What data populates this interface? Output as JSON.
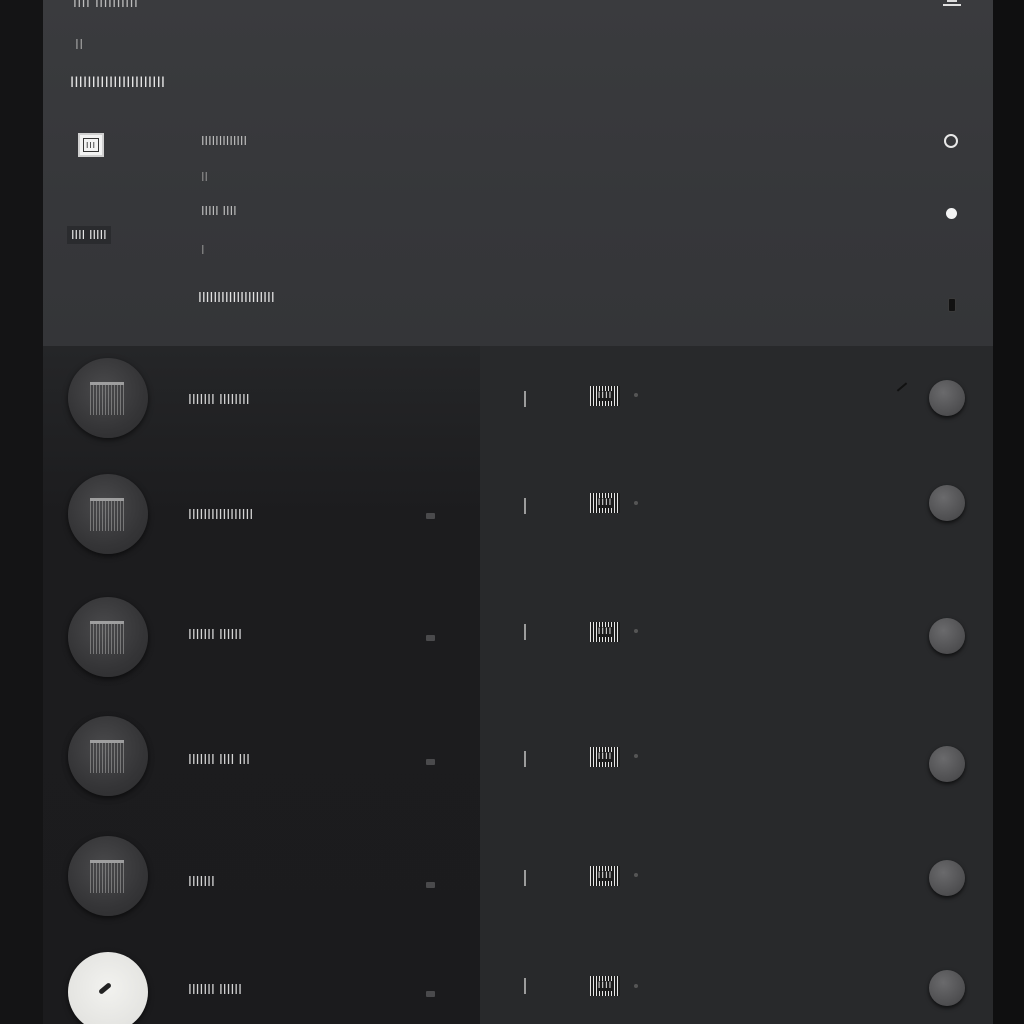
{
  "header": {
    "top_title": "IIII IIIIIIIIII",
    "top_icon": "window-icon",
    "subtitle": "II",
    "heading": "IIIIIIIIIIIIIIIIIIIIII",
    "badge_text": "III",
    "side_label": "IIII IIIII",
    "fields": [
      {
        "label": "IIIIIIIIIIIII",
        "sub": "II",
        "icon": "alarm-icon"
      },
      {
        "label": "IIIII   IIII",
        "sub": "I",
        "icon": "dot-icon"
      },
      {
        "label": "IIIIIIIIIIIIIIIIIIII",
        "icon": "small-square-icon"
      }
    ]
  },
  "rows": [
    {
      "label": "IIIIIII IIIIIIII",
      "code": "IIII",
      "avatar": "dark"
    },
    {
      "label": "IIIIIIIIIIIIIIIII",
      "code": "IIII",
      "avatar": "dark"
    },
    {
      "label": "IIIIIII IIIIII",
      "code": "IIII",
      "avatar": "dark"
    },
    {
      "label": "IIIIIII IIII III",
      "code": "IIII",
      "avatar": "dark"
    },
    {
      "label": "IIIIIII",
      "code": "IIII",
      "avatar": "dark"
    },
    {
      "label": "IIIIIII IIIIII",
      "code": "IIII",
      "avatar": "light"
    }
  ],
  "colors": {
    "header_bg": "#38393c",
    "panel_left": "#1c1c1e",
    "panel_right": "#28292b",
    "text": "#d4d4d4"
  }
}
